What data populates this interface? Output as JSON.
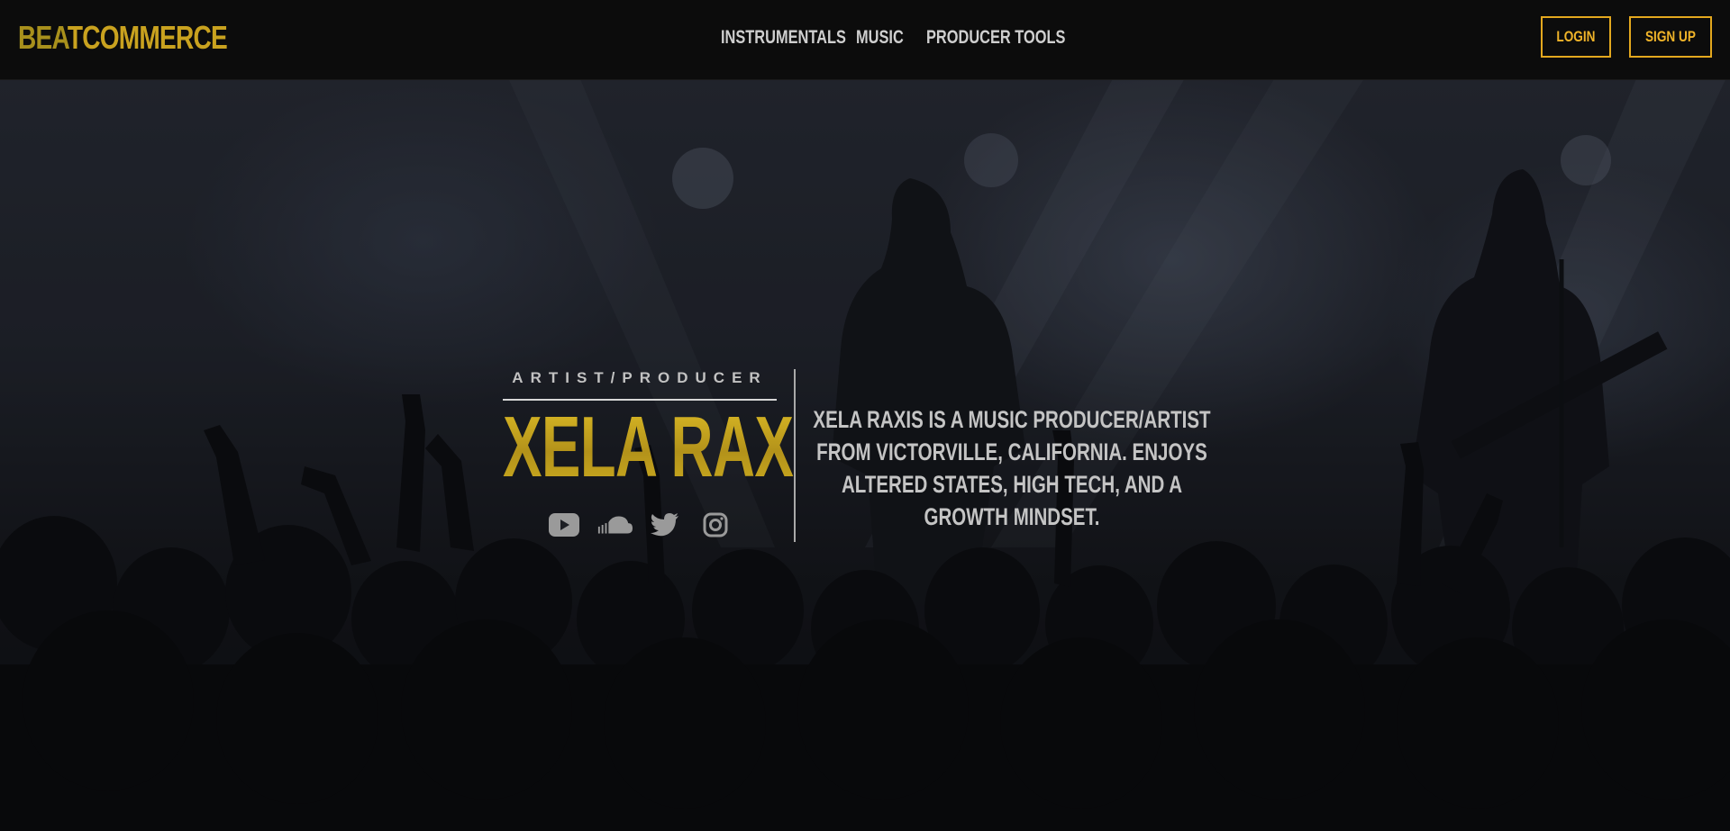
{
  "navbar": {
    "brand_part1": "BEA",
    "brand_part2": "TCOMMERCE",
    "links": [
      "INSTRUMENTALS",
      "MUSIC",
      "PRODUCER TOOLS"
    ],
    "login_label": "LOGIN",
    "signup_label": "SIGN UP"
  },
  "hero": {
    "subtitle": "ARTIST/PRODUCER",
    "artist_name": "XELA RAX",
    "bio": "XELA RAXIS IS A MUSIC PRODUCER/ARTIST FROM VICTORVILLE, CALIFORNIA. ENJOYS ALTERED STATES, HIGH TECH, AND A GROWTH MINDSET.",
    "socials": [
      "youtube-icon",
      "soundcloud-icon",
      "twitter-icon",
      "instagram-icon"
    ]
  },
  "colors": {
    "accent": "#e3a81e",
    "brand_gold": "#c9a21f",
    "nav_text": "#cfcfcf",
    "navbar_bg": "#0c0c0c"
  }
}
